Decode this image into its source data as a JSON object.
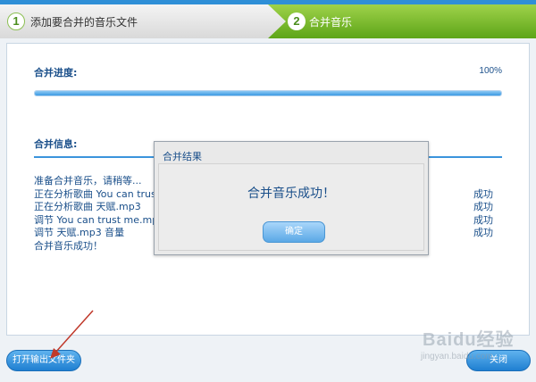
{
  "steps": [
    {
      "number": "1",
      "label": "添加要合并的音乐文件"
    },
    {
      "number": "2",
      "label": "合并音乐"
    }
  ],
  "progress": {
    "title": "合并进度:",
    "percent_text": "100%",
    "value": 1.0
  },
  "info": {
    "title": "合并信息:",
    "log": [
      {
        "text": "准备合并音乐，请稍等...",
        "status": ""
      },
      {
        "text": "正在分析歌曲 You can trus",
        "status": "成功"
      },
      {
        "text": "正在分析歌曲 天赋.mp3",
        "status": "成功"
      },
      {
        "text": "调节 You can trust me.mp3",
        "status": "成功"
      },
      {
        "text": "调节 天赋.mp3 音量",
        "status": "成功"
      },
      {
        "text": "合并音乐成功！",
        "status": ""
      }
    ]
  },
  "dialog": {
    "title": "合并结果",
    "message": "合并音乐成功！",
    "ok_label": "确定"
  },
  "buttons": {
    "open_output": "打开输出文件夹",
    "close": "关闭"
  },
  "watermark": {
    "text": "Baidu经验",
    "sub": "jingyan.baidu.com"
  },
  "colors": {
    "accent": "#2f8fd7",
    "step_active": "#5da518",
    "text": "#1a4f8a",
    "annotation": "#c0392b"
  }
}
